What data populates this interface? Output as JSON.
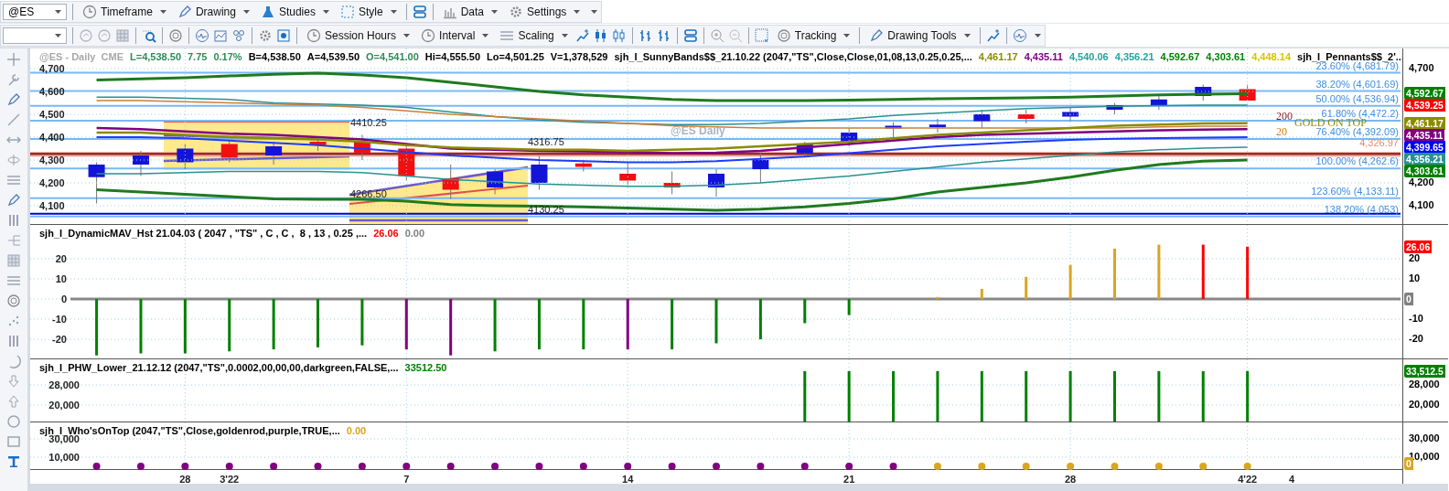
{
  "toolbar": {
    "symbol": "@ES",
    "menus": [
      {
        "label": "Timeframe"
      },
      {
        "label": "Drawing"
      },
      {
        "label": "Studies"
      },
      {
        "label": "Style"
      },
      {
        "label": "Data"
      },
      {
        "label": "Settings"
      }
    ]
  },
  "toolbar_2": {
    "menus": [
      {
        "label": "Session Hours"
      },
      {
        "label": "Interval"
      },
      {
        "label": "Scaling"
      },
      {
        "label": "Tracking"
      },
      {
        "label": "Drawing Tools"
      }
    ]
  },
  "price_panel": {
    "quote": [
      {
        "text": "@ES - Daily  CME",
        "color": "#a8a8a8"
      },
      {
        "text": "L=4,538.50",
        "color": "#2e8b57"
      },
      {
        "text": "7.75",
        "color": "#2e8b57"
      },
      {
        "text": "0.17%",
        "color": "#2e8b57"
      },
      {
        "text": "B=4,538.50",
        "color": "#000000"
      },
      {
        "text": "A=4,539.50",
        "color": "#000000"
      },
      {
        "text": "O=4,541.00",
        "color": "#2e8b57"
      },
      {
        "text": "Hi=4,555.50",
        "color": "#000000"
      },
      {
        "text": "Lo=4,501.25",
        "color": "#000000"
      },
      {
        "text": "V=1,378,529",
        "color": "#000000"
      }
    ],
    "study": "sjh_I_SunnyBands$$_21.10.22 (2047,\"TS\",Close,Close,01,08,13,0.25,0.25,...",
    "readings": [
      {
        "text": "4,461.17",
        "color": "#8b8b00"
      },
      {
        "text": "4,435.11",
        "color": "#800080"
      },
      {
        "text": "4,540.06",
        "color": "#2aa0a0"
      },
      {
        "text": "4,356.21",
        "color": "#2aa0a0"
      },
      {
        "text": "4,592.67",
        "color": "#008000"
      },
      {
        "text": "4,303.61",
        "color": "#008000"
      },
      {
        "text": "4,448.14",
        "color": "#d4c400"
      }
    ],
    "study_2": "sjh_I_Pennants$$_2'...",
    "watermark": "@ES Daily",
    "chart_data": {
      "type": "line",
      "categories": [
        null,
        null,
        null,
        null,
        null,
        null,
        null,
        null,
        null,
        null,
        null,
        null,
        null,
        null,
        null,
        null,
        null,
        null,
        null,
        null,
        null,
        null,
        null,
        null,
        null,
        null,
        null,
        null,
        null,
        null,
        null
      ],
      "ylim": [
        4020,
        4788
      ],
      "grid": true,
      "yticks": [
        {
          "value": 4700,
          "label": "4,700"
        },
        {
          "value": 4600,
          "label": "4,600"
        },
        {
          "value": 4500,
          "label": "4,500"
        },
        {
          "value": 4400,
          "label": "4,400"
        },
        {
          "value": 4300,
          "label": "4,300"
        },
        {
          "value": 4200,
          "label": "4,200"
        },
        {
          "value": 4100,
          "label": "4,100"
        }
      ],
      "series": [
        {
          "color": "#1f7a1f",
          "values": [
            null,
            4650,
            4655,
            4660,
            4668,
            4675,
            4680,
            4672,
            4660,
            4640,
            4620,
            4600,
            4585,
            4575,
            4565,
            4560,
            4560,
            4560,
            4562,
            4565,
            4568,
            4570,
            4572,
            4575,
            4580,
            4585,
            4588,
            4590,
            null,
            null,
            null
          ]
        },
        {
          "color": "#1f7a1f",
          "values": [
            null,
            4170,
            4160,
            4150,
            4140,
            4130,
            4128,
            4128,
            4120,
            4105,
            4100,
            4098,
            4095,
            4090,
            4085,
            4080,
            4085,
            4095,
            4110,
            4130,
            4160,
            4180,
            4200,
            4225,
            4255,
            4280,
            4295,
            4300,
            null,
            null,
            null
          ]
        },
        {
          "color": "#2a9090",
          "values": [
            null,
            4575,
            4575,
            4570,
            4565,
            4550,
            4545,
            4540,
            4530,
            4510,
            4490,
            4475,
            4465,
            4460,
            4455,
            4455,
            4460,
            4470,
            4480,
            4495,
            4505,
            4515,
            4525,
            4530,
            4535,
            4538,
            4540,
            4540,
            null,
            null,
            null
          ]
        },
        {
          "color": "#2a9090",
          "values": [
            null,
            4240,
            4240,
            4245,
            4250,
            4250,
            4250,
            4245,
            4230,
            4215,
            4205,
            4195,
            4190,
            4185,
            4185,
            4190,
            4200,
            4215,
            4230,
            4250,
            4270,
            4290,
            4305,
            4320,
            4335,
            4345,
            4352,
            4356,
            null,
            null,
            null
          ]
        },
        {
          "color": "#c8803a",
          "values": [
            null,
            4560,
            4560,
            4555,
            4550,
            4545,
            4540,
            4530,
            4515,
            4500,
            4490,
            4480,
            4470,
            4460,
            4450,
            4445,
            4440,
            4440,
            4440,
            4440,
            4440,
            4440,
            4440,
            4440,
            4440,
            4445,
            4448,
            4448,
            null,
            null,
            null
          ]
        },
        {
          "color": "#800080",
          "values": [
            null,
            4440,
            4435,
            4425,
            4415,
            4410,
            4400,
            4390,
            4370,
            4350,
            4345,
            4340,
            4338,
            4335,
            4330,
            4332,
            4340,
            4355,
            4370,
            4385,
            4400,
            4410,
            4415,
            4420,
            4425,
            4430,
            4433,
            4435,
            null,
            null,
            null
          ]
        },
        {
          "color": "#8b8b00",
          "values": [
            null,
            4420,
            4420,
            4410,
            4400,
            4395,
            4390,
            4380,
            4365,
            4355,
            4350,
            4345,
            4345,
            4340,
            4345,
            4350,
            4360,
            4370,
            4380,
            4395,
            4410,
            4420,
            4430,
            4440,
            4450,
            4455,
            4460,
            4461,
            null,
            null,
            null
          ]
        },
        {
          "color": "#1e3cff",
          "values": [
            null,
            4400,
            4400,
            4395,
            4385,
            4375,
            4365,
            4350,
            4335,
            4320,
            4310,
            4300,
            4295,
            4290,
            4290,
            4295,
            4305,
            4315,
            4330,
            4345,
            4360,
            4370,
            4380,
            4388,
            4393,
            4396,
            4398,
            4400,
            null,
            null,
            null
          ]
        }
      ]
    },
    "right_ticks": [
      "4,700",
      "4,200",
      "4,100"
    ],
    "pivots": [
      "4410.25",
      "4316.75",
      "4266.50",
      "4130.25"
    ],
    "fib_levels": [
      "23.60% (4,681.79)",
      "38.20% (4,601.69)",
      "50.00% (4,536.94)",
      "61.80% (4,472.2)",
      "76.40% (4,392.09)",
      "100.00% (4,262.6)",
      "123.60% (4,133.11)",
      "138.20% (4,053)"
    ],
    "notes": [
      {
        "text": "200",
        "color": "#8b1a1a"
      },
      {
        "text": "20",
        "color": "#e07b00"
      },
      {
        "text": "GOLD ON TOP",
        "color": "#8b8b00"
      }
    ],
    "line_label": "4,326.97",
    "tags": [
      {
        "text": "4,592.67",
        "color": "#008000"
      },
      {
        "text": "4,539.25",
        "color": "#ff0000"
      },
      {
        "text": "4,461.17",
        "color": "#8b8b00"
      },
      {
        "text": "4,435.11",
        "color": "#800080"
      },
      {
        "text": "4,399.65",
        "color": "#0000ff"
      },
      {
        "text": "4,356.21",
        "color": "#2a9090"
      },
      {
        "text": "4,303.61",
        "color": "#008000"
      }
    ]
  },
  "histogram_panel": {
    "study": "sjh_I_DynamicMAV_Hst 21.04.03 ( 2047 , \"TS\" , C , C ,  8 , 13 , 0.25 ,...",
    "readings": [
      {
        "text": "26.06",
        "color": "#ff0000"
      },
      {
        "text": "0.00",
        "color": "#808080"
      }
    ],
    "chart_data": {
      "type": "bar",
      "categories": [
        null,
        null,
        null,
        null,
        null,
        null,
        null,
        null,
        null,
        null,
        null,
        null,
        null,
        null,
        null,
        null,
        null,
        null,
        null,
        null,
        null,
        null,
        null,
        null,
        null,
        null,
        null,
        null,
        null,
        null,
        null
      ],
      "ylim": [
        -29.5,
        36.8
      ],
      "yticks": [
        -20,
        -10,
        0,
        10,
        20
      ],
      "grid": true,
      "series": [
        {
          "color": "#008000",
          "values": [
            null,
            -28,
            -27,
            -27,
            -26,
            -25,
            -24,
            -23,
            null,
            null,
            -26,
            -25,
            -25,
            null,
            -25,
            -22,
            -20,
            -12,
            -8,
            null,
            null,
            null,
            null,
            null,
            null,
            null,
            null,
            null,
            null,
            null,
            null
          ]
        },
        {
          "color": "#800080",
          "values": [
            null,
            null,
            null,
            null,
            null,
            null,
            null,
            null,
            -25,
            -28,
            null,
            null,
            null,
            -25,
            null,
            null,
            null,
            null,
            null,
            null,
            null,
            null,
            null,
            null,
            null,
            null,
            null,
            null,
            null,
            null,
            null
          ]
        },
        {
          "color": "#daa520",
          "values": [
            null,
            null,
            null,
            null,
            null,
            null,
            null,
            null,
            null,
            null,
            null,
            null,
            null,
            null,
            null,
            null,
            null,
            null,
            null,
            null,
            1,
            5,
            11,
            17,
            25,
            27,
            null,
            null,
            null,
            null,
            null
          ]
        },
        {
          "color": "#ff0000",
          "values": [
            null,
            null,
            null,
            null,
            null,
            null,
            null,
            null,
            null,
            null,
            null,
            null,
            null,
            null,
            null,
            null,
            null,
            null,
            null,
            null,
            null,
            null,
            null,
            null,
            null,
            null,
            27,
            26,
            null,
            null,
            null
          ]
        }
      ]
    },
    "right_ticks": [
      "20",
      "10",
      "-10",
      "-20"
    ],
    "tags": [
      {
        "text": "26.06",
        "color": "#ff0000"
      },
      {
        "text": "0",
        "color": "#808080"
      }
    ]
  },
  "phw_panel": {
    "study": "sjh_I_PHW_Lower_21.12.12 (2047,\"TS\",0.0002,00,00,00,darkgreen,FALSE,...",
    "readings": [
      {
        "text": "33512.50",
        "color": "#008000"
      }
    ],
    "chart_data": {
      "type": "bar",
      "categories": [
        null,
        null,
        null,
        null,
        null,
        null,
        null,
        null,
        null,
        null,
        null,
        null,
        null,
        null,
        null,
        null,
        null,
        null,
        null,
        null,
        null,
        null,
        null,
        null,
        null,
        null,
        null,
        null,
        null,
        null,
        null
      ],
      "ylim": [
        13455,
        38182
      ],
      "yticks": [
        {
          "value": 20000,
          "label": "20,000"
        },
        {
          "value": 28000,
          "label": "28,000"
        }
      ],
      "grid": true,
      "series": [
        {
          "color": "#008000",
          "values": [
            null,
            null,
            null,
            null,
            null,
            null,
            null,
            null,
            null,
            null,
            null,
            null,
            null,
            null,
            null,
            null,
            null,
            33500,
            33500,
            33500,
            33500,
            33500,
            33500,
            33500,
            33500,
            33500,
            33500,
            33500,
            null,
            null,
            null
          ]
        }
      ]
    },
    "tags": [
      {
        "text": "33,512.5",
        "color": "#008000"
      }
    ]
  },
  "whos_on_top_panel": {
    "study": "sjh_I_Who'sOnTop (2047,\"TS\",Close,goldenrod,purple,TRUE,...",
    "readings": [
      {
        "text": "0.00",
        "color": "#daa520"
      }
    ],
    "chart_data": {
      "type": "scatter",
      "categories": [
        null,
        null,
        null,
        "28",
        "3'22",
        null,
        null,
        null,
        "7",
        null,
        null,
        null,
        null,
        "14",
        null,
        null,
        null,
        null,
        "21",
        null,
        null,
        null,
        null,
        "28",
        null,
        null,
        null,
        "4'22",
        "4",
        null,
        null
      ],
      "ylim": [
        -3000,
        48000
      ],
      "yticks": [
        {
          "value": 10000,
          "label": "10,000"
        },
        {
          "value": 30000,
          "label": "30,000"
        }
      ],
      "grid": true,
      "series": [
        {
          "color": "#800080",
          "values": [
            null,
            0,
            0,
            0,
            0,
            0,
            0,
            0,
            0,
            0,
            0,
            0,
            0,
            0,
            0,
            0,
            0,
            0,
            0,
            0,
            null,
            null,
            null,
            null,
            null,
            null,
            null,
            null,
            null,
            null,
            null
          ]
        },
        {
          "color": "#daa520",
          "values": [
            null,
            null,
            null,
            null,
            null,
            null,
            null,
            null,
            null,
            null,
            null,
            null,
            null,
            null,
            null,
            null,
            null,
            null,
            null,
            null,
            0,
            0,
            0,
            0,
            0,
            0,
            0,
            0,
            null,
            null,
            null
          ]
        }
      ]
    },
    "tags": [
      {
        "text": "0",
        "color": "#daa520"
      }
    ]
  }
}
